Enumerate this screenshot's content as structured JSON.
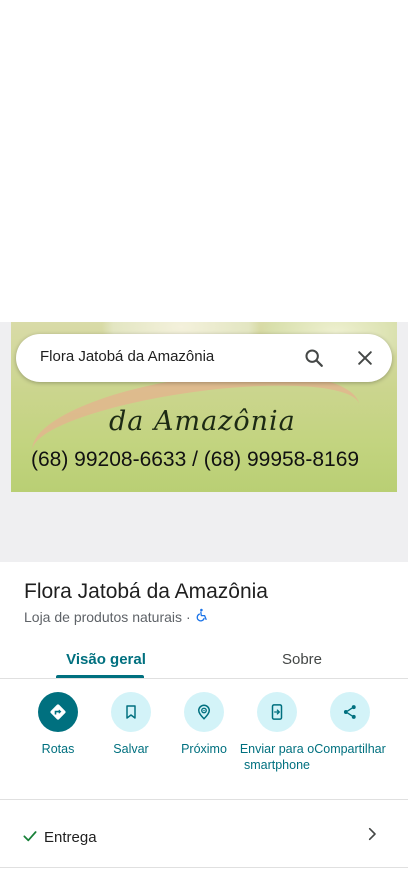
{
  "search": {
    "query": "Flora Jatobá da Amazônia"
  },
  "photo": {
    "script_text": "da Amazônia",
    "phones": "(68) 99208-6633 / (68) 99958-8169"
  },
  "place": {
    "name": "Flora Jatobá da Amazônia",
    "category": "Loja de produtos naturais",
    "separator": "·"
  },
  "tabs": [
    {
      "label": "Visão geral",
      "active": true
    },
    {
      "label": "Sobre",
      "active": false
    }
  ],
  "actions": [
    {
      "label": "Rotas",
      "icon": "directions-icon"
    },
    {
      "label": "Salvar",
      "icon": "bookmark-icon"
    },
    {
      "label": "Próximo",
      "icon": "nearby-icon"
    },
    {
      "label": "Enviar para o smartphone",
      "icon": "send-to-phone-icon"
    },
    {
      "label": "Compartilhar",
      "icon": "share-icon"
    }
  ],
  "rows": [
    {
      "label": "Entrega",
      "status": "check"
    }
  ],
  "colors": {
    "accent": "#00707f",
    "accent_light": "#d3f3f8",
    "wheelchair": "#1a73e8"
  }
}
